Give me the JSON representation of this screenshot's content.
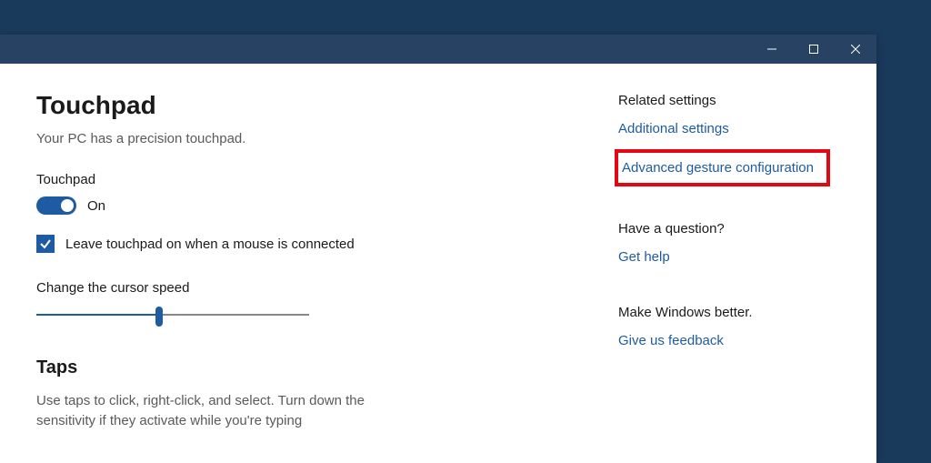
{
  "page": {
    "title": "Touchpad",
    "subtitle": "Your PC has a precision touchpad."
  },
  "touchpad": {
    "label": "Touchpad",
    "toggle_state": "On",
    "checkbox_label": "Leave touchpad on when a mouse is connected"
  },
  "cursor_speed": {
    "label": "Change the cursor speed"
  },
  "taps": {
    "heading": "Taps",
    "description": "Use taps to click, right-click, and select. Turn down the sensitivity if they activate while you're typing"
  },
  "related": {
    "heading": "Related settings",
    "links": {
      "additional": "Additional settings",
      "advanced": "Advanced gesture configuration"
    }
  },
  "question": {
    "heading": "Have a question?",
    "link": "Get help"
  },
  "feedback": {
    "heading": "Make Windows better.",
    "link": "Give us feedback"
  }
}
